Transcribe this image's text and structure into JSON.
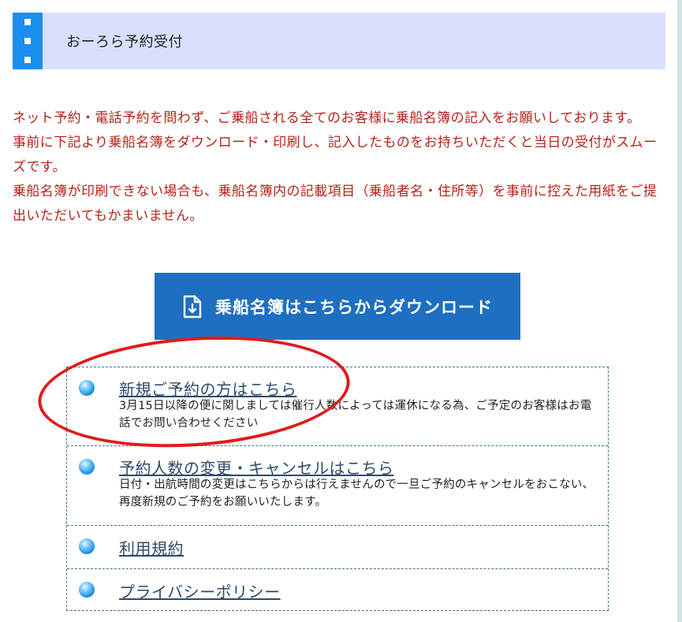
{
  "header": {
    "title": "おーろら予約受付"
  },
  "notice": {
    "paragraphs": [
      "ネット予約・電話予約を問わず、ご乗船される全てのお客様に乗船名簿の記入をお願いしております。",
      "事前に下記より乗船名簿をダウンロード・印刷し、記入したものをお持ちいただくと当日の受付がスムーズです。",
      "乗船名簿が印刷できない場合も、乗船名簿内の記載項目（乗船者名・住所等）を事前に控えた用紙をご提出いただいてもかまいません。"
    ],
    "color": "#b5231a"
  },
  "download_button": {
    "label": "乗船名簿はこちらからダウンロード",
    "icon": "file-download-icon",
    "color": "#1e6fc1"
  },
  "links": [
    {
      "title": "新規ご予約の方はこちら",
      "description": "3月15日以降の便に関しましては催行人数によっては運休になる為、ご予定のお客様はお電話でお問い合わせください"
    },
    {
      "title": "予約人数の変更・キャンセルはこちら",
      "description": "日付・出航時間の変更はこちらからは行えませんので一旦ご予約のキャンセルをおこない、再度新規のご予約をお願いいたします。"
    },
    {
      "title": "利用規約",
      "description": ""
    },
    {
      "title": "プライバシーポリシー",
      "description": ""
    }
  ],
  "accent_colors": {
    "header_bar": "#1a8ff0",
    "header_bg": "#d9e0ff",
    "highlight_circle": "#e11b1b"
  }
}
